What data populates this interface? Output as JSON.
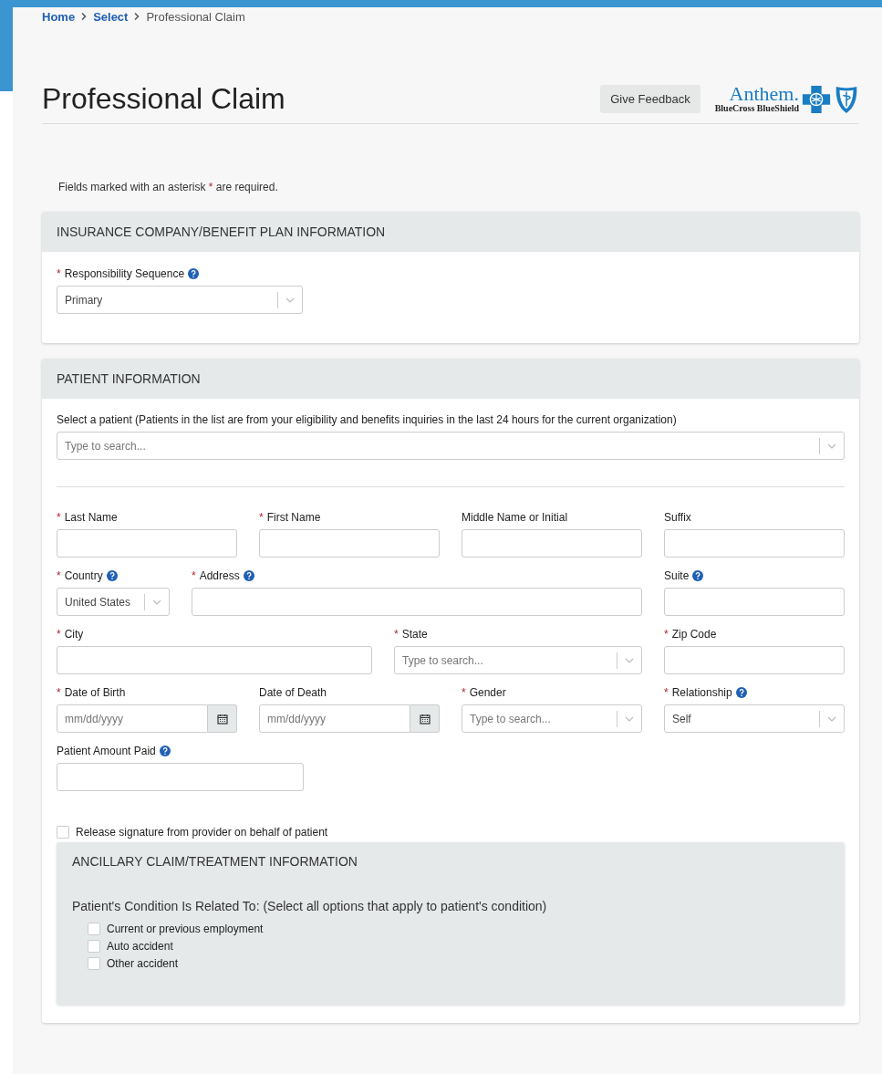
{
  "breadcrumb": [
    {
      "label": "Home",
      "link": true
    },
    {
      "label": "Select",
      "link": true
    },
    {
      "label": "Professional Claim",
      "link": false
    }
  ],
  "page_title": "Professional Claim",
  "feedback_button": "Give Feedback",
  "logo": {
    "name": "Anthem.",
    "tagline": "BlueCross BlueShield"
  },
  "required_note": {
    "before": "Fields marked with an asterisk",
    "mark": "*",
    "after": "are required."
  },
  "insurance_section": {
    "title": "INSURANCE COMPANY/BENEFIT PLAN INFORMATION",
    "field": {
      "label": "Responsibility Sequence",
      "required": true,
      "help": true,
      "kind": "select",
      "value": "Primary"
    }
  },
  "patient_section": {
    "title": "PATIENT INFORMATION",
    "patient_search": {
      "label": "Select a patient (Patients in the list are from your eligibility and benefits inquiries in the last 24 hours for the current organization)",
      "placeholder": "Type to search..."
    },
    "rows": [
      [
        {
          "label": "Last Name",
          "required": true,
          "help": false,
          "kind": "text"
        },
        {
          "label": "First Name",
          "required": true,
          "help": false,
          "kind": "text"
        },
        {
          "label": "Middle Name or Initial",
          "required": false,
          "help": false,
          "kind": "text"
        },
        {
          "label": "Suffix",
          "required": false,
          "help": false,
          "kind": "text"
        }
      ],
      [
        {
          "label": "Country",
          "required": true,
          "help": true,
          "kind": "select",
          "value": "United States"
        },
        {
          "label": "Address",
          "required": true,
          "help": true,
          "kind": "text"
        },
        {
          "label": "Suite",
          "required": false,
          "help": true,
          "kind": "text"
        }
      ],
      [
        {
          "label": "City",
          "required": true,
          "help": false,
          "kind": "text"
        },
        {
          "label": "State",
          "required": true,
          "help": false,
          "kind": "select",
          "placeholder": "Type to search..."
        },
        {
          "label": "Zip Code",
          "required": true,
          "help": false,
          "kind": "text"
        }
      ],
      [
        {
          "label": "Date of Birth",
          "required": true,
          "help": false,
          "kind": "date",
          "placeholder": "mm/dd/yyyy"
        },
        {
          "label": "Date of Death",
          "required": false,
          "help": false,
          "kind": "date",
          "placeholder": "mm/dd/yyyy"
        },
        {
          "label": "Gender",
          "required": true,
          "help": false,
          "kind": "select",
          "placeholder": "Type to search..."
        },
        {
          "label": "Relationship",
          "required": true,
          "help": true,
          "kind": "select",
          "value": "Self"
        }
      ],
      [
        {
          "label": "Patient Amount Paid",
          "required": false,
          "help": true,
          "kind": "text"
        }
      ]
    ],
    "release_signature": {
      "label": "Release signature from provider on behalf of patient",
      "checked": false
    },
    "ancillary": {
      "title": "ANCILLARY CLAIM/TREATMENT INFORMATION",
      "question": "Patient's Condition Is Related To: (Select all options that apply to patient's condition)",
      "options": [
        {
          "label": "Current or previous employment",
          "checked": false
        },
        {
          "label": "Auto accident",
          "checked": false
        },
        {
          "label": "Other accident",
          "checked": false
        }
      ]
    }
  }
}
